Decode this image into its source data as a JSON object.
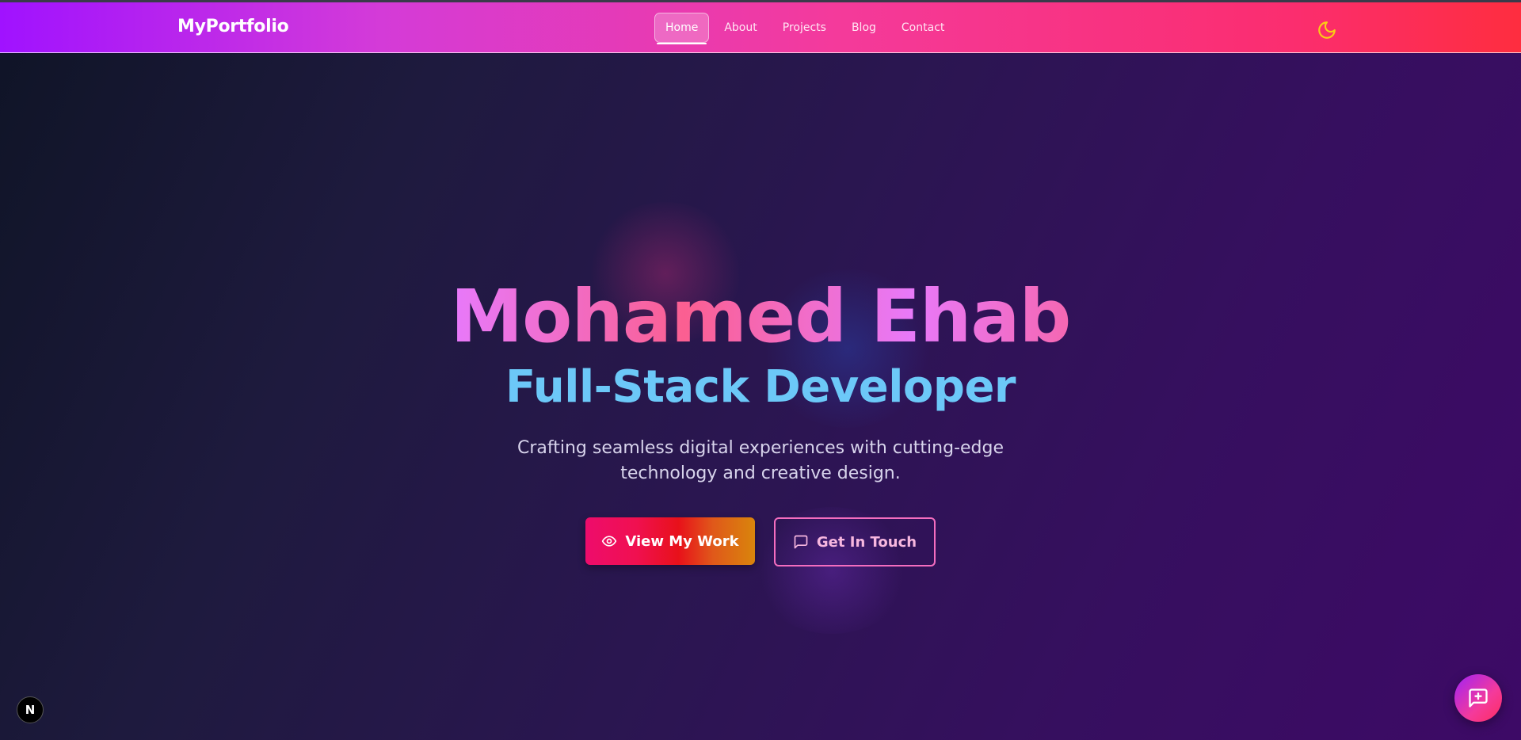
{
  "header": {
    "brand": "MyPortfolio",
    "nav": [
      {
        "label": "Home",
        "active": true
      },
      {
        "label": "About"
      },
      {
        "label": "Projects"
      },
      {
        "label": "Blog"
      },
      {
        "label": "Contact"
      }
    ],
    "theme_toggle_icon": "moon-icon",
    "theme_toggle_color": "#facc15"
  },
  "hero": {
    "name": "Mohamed Ehab",
    "role": "Full-Stack Developer",
    "description": "Crafting seamless digital experiences with cutting-edge technology and creative design.",
    "primary_button": {
      "label": "View My Work",
      "icon": "eye-icon"
    },
    "secondary_button": {
      "label": "Get In Touch",
      "icon": "message-square-icon"
    }
  },
  "dev_badge": {
    "label": "N"
  },
  "chat_fab": {
    "icon": "message-square-plus-icon"
  },
  "colors": {
    "name_gradient": [
      "#e879f9",
      "#fb5f91"
    ],
    "role_color": "#6cc8f8",
    "secondary_border": "#f46dbf"
  }
}
